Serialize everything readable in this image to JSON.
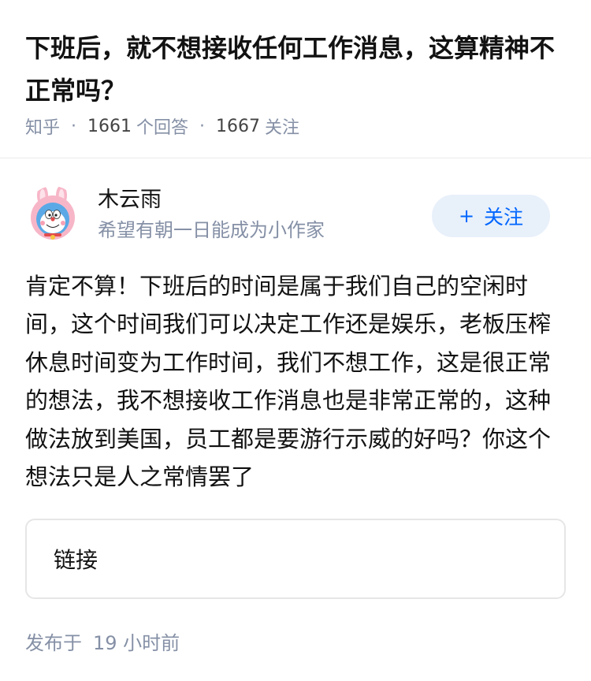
{
  "question": {
    "title": "下班后，就不想接收任何工作消息，这算精神不正常吗？",
    "source": "知乎",
    "separator": "·",
    "answer_count": "1661",
    "answer_suffix": "个回答",
    "follower_count": "1667",
    "follower_suffix": "关注"
  },
  "author": {
    "name": "木云雨",
    "bio": "希望有朝一日能成为小作家",
    "avatar_icon": "doraemon-bunny-avatar",
    "follow_plus": "+",
    "follow_label": "关注"
  },
  "answer": {
    "text": "肯定不算！下班后的时间是属于我们自己的空闲时间，这个时间我们可以决定工作还是娱乐，老板压榨休息时间变为工作时间，我们不想工作，这是很正常的想法，我不想接收工作消息也是非常正常的，这种做法放到美国，员工都是要游行示威的好吗？你这个想法只是人之常情罢了"
  },
  "link_card": {
    "label": "链接"
  },
  "footer": {
    "published_prefix": "发布于",
    "published_time": "19 小时前"
  },
  "colors": {
    "accent": "#0066ff",
    "follow_bg": "#e8f0fa",
    "meta_gray": "#8590a6",
    "text": "#121212"
  }
}
